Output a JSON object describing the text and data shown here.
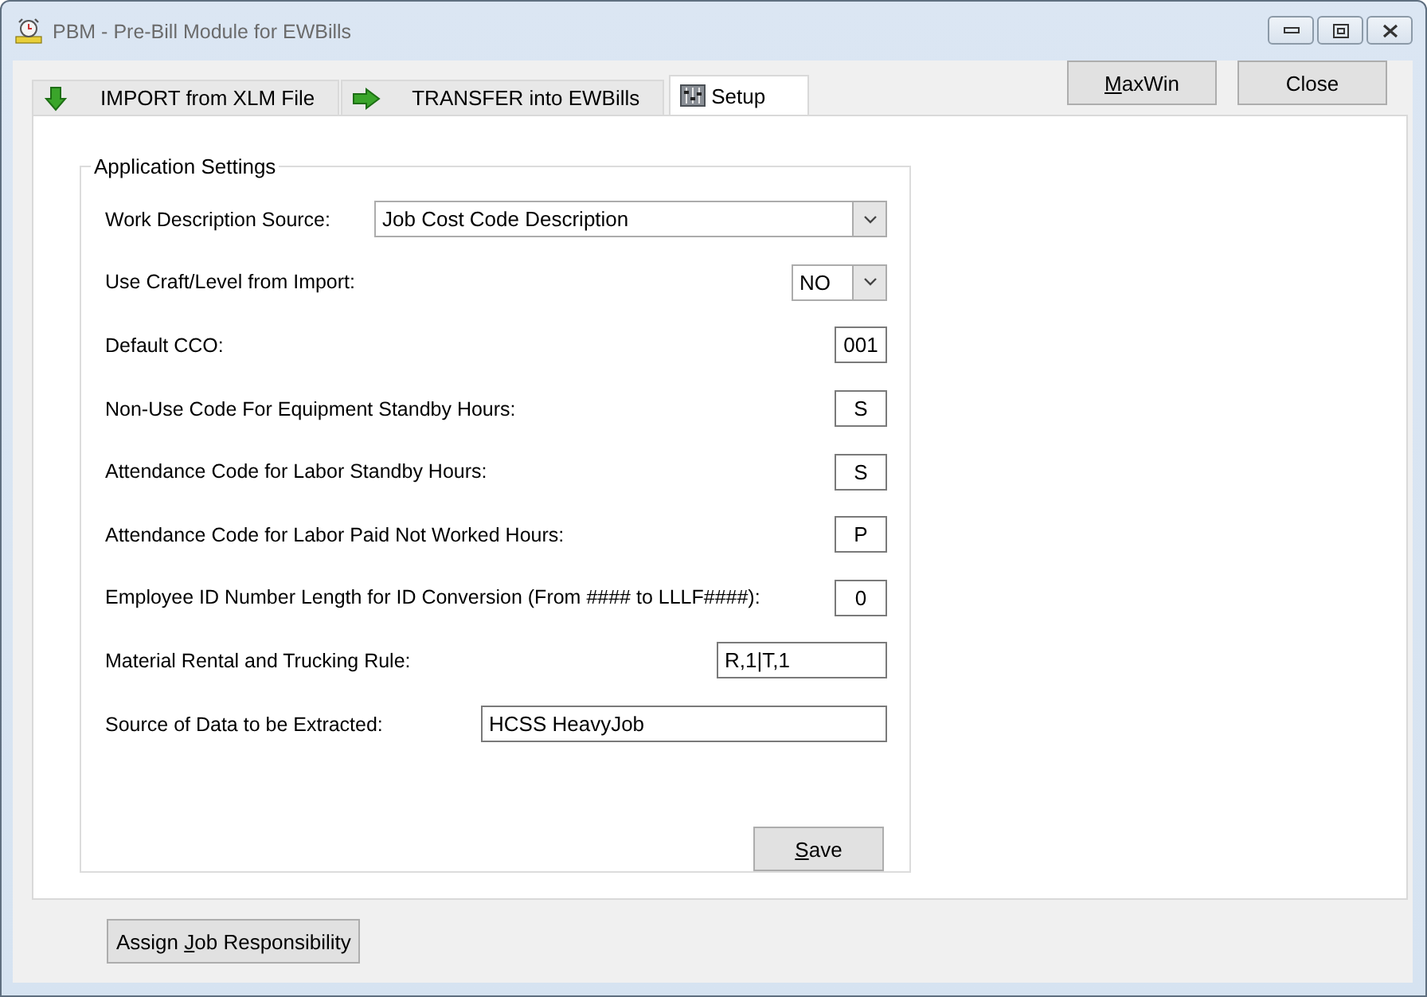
{
  "window": {
    "title": "PBM - Pre-Bill Module for EWBills"
  },
  "tabs": [
    {
      "label": "IMPORT from XLM File",
      "selected": false
    },
    {
      "label": "TRANSFER into EWBills",
      "selected": false
    },
    {
      "label": "Setup",
      "selected": true
    }
  ],
  "header_buttons": [
    {
      "label_parts": [
        {
          "text": "M",
          "underlined": true
        },
        {
          "text": "axWin",
          "underlined": false
        }
      ]
    },
    {
      "label_parts": [
        {
          "text": "Close",
          "underlined": false
        }
      ]
    }
  ],
  "settings_group": {
    "title": "Application Settings",
    "fields": [
      {
        "label": "Work Description Source:",
        "kind": "dropdown",
        "value": "Job Cost Code Description"
      },
      {
        "label": "Use Craft/Level from Import:",
        "kind": "dropdown",
        "value": "NO"
      },
      {
        "label": "Default CCO:",
        "kind": "text",
        "value": "001"
      },
      {
        "label": "Non-Use Code For Equipment Standby Hours:",
        "kind": "text",
        "value": "S"
      },
      {
        "label": "Attendance Code for Labor Standby Hours:",
        "kind": "text",
        "value": "S"
      },
      {
        "label": "Attendance Code for Labor Paid Not Worked Hours:",
        "kind": "text",
        "value": "P"
      },
      {
        "label": "Employee ID Number Length for ID Conversion (From #### to LLLF####):",
        "kind": "text",
        "value": "0"
      },
      {
        "label": "Material Rental and Trucking Rule:",
        "kind": "text",
        "value": "R,1|T,1"
      },
      {
        "label": "Source of Data to be Extracted:",
        "kind": "text",
        "value": "HCSS HeavyJob"
      }
    ],
    "save_button": {
      "label_parts": [
        {
          "text": "S",
          "underlined": true
        },
        {
          "text": "ave",
          "underlined": false
        }
      ]
    }
  },
  "footer_button": {
    "label_parts": [
      {
        "text": "Assign ",
        "underlined": false
      },
      {
        "text": "J",
        "underlined": true
      },
      {
        "text": "ob Responsibility",
        "underlined": false
      }
    ]
  }
}
